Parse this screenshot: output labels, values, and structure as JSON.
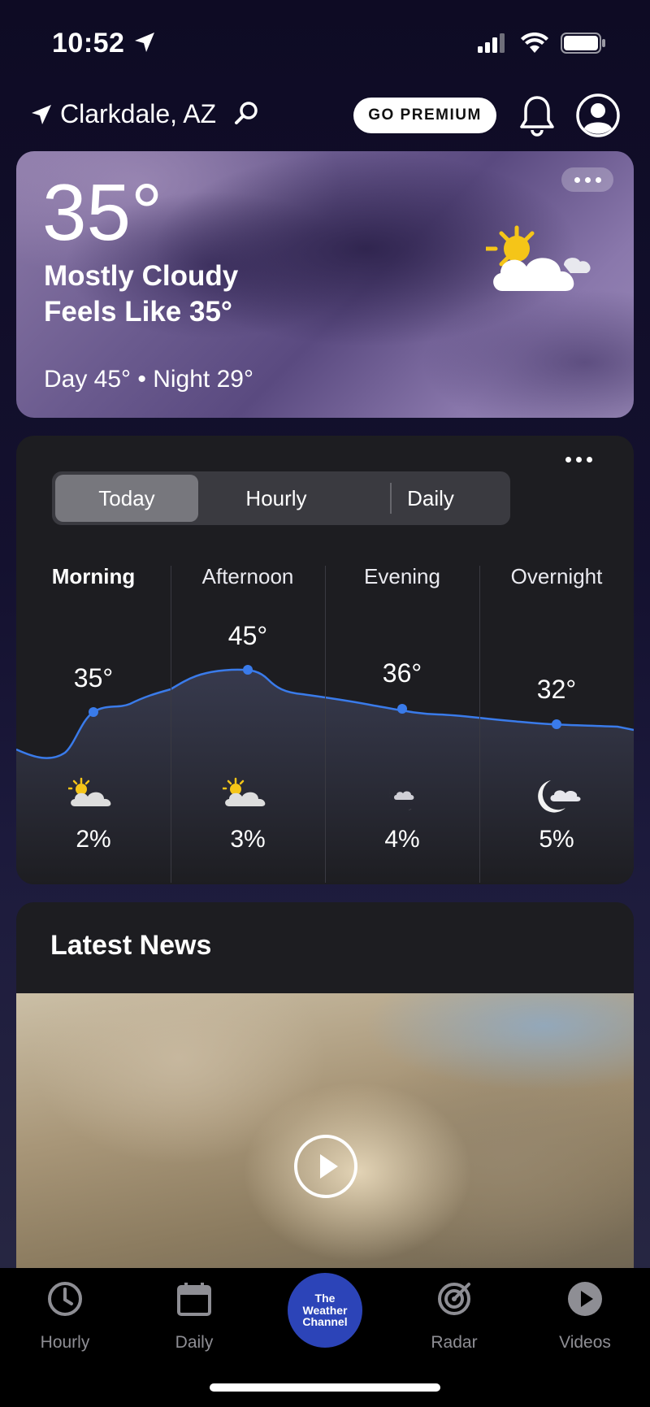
{
  "status_bar": {
    "time": "10:52"
  },
  "header": {
    "location": "Clarkdale, AZ",
    "premium_label": "GO PREMIUM"
  },
  "current": {
    "temperature": "35°",
    "condition": "Mostly Cloudy",
    "feels_like": "Feels Like 35°",
    "day_night": "Day 45° • Night 29°",
    "icon": "partly-cloudy-icon"
  },
  "forecast": {
    "tabs": [
      "Today",
      "Hourly",
      "Daily"
    ],
    "selected_tab": "Today",
    "periods": [
      {
        "label": "Morning",
        "temp": "35°",
        "precip": "2%",
        "icon": "partly-cloudy-day-icon"
      },
      {
        "label": "Afternoon",
        "temp": "45°",
        "precip": "3%",
        "icon": "partly-cloudy-day-icon"
      },
      {
        "label": "Evening",
        "temp": "36°",
        "precip": "4%",
        "icon": "night-cloudy-icon"
      },
      {
        "label": "Overnight",
        "temp": "32°",
        "precip": "5%",
        "icon": "night-cloudy-icon"
      }
    ]
  },
  "news": {
    "title": "Latest News"
  },
  "tab_bar": {
    "items": [
      {
        "label": "Hourly",
        "icon": "clock-icon"
      },
      {
        "label": "Daily",
        "icon": "calendar-icon"
      },
      {
        "label": "Radar",
        "icon": "radar-icon"
      },
      {
        "label": "Videos",
        "icon": "play-icon"
      }
    ],
    "logo_lines": [
      "The",
      "Weather",
      "Channel"
    ]
  },
  "colors": {
    "accent_blue": "#3a7bea",
    "logo_blue": "#2c44b8",
    "card_bg": "#1d1d21"
  }
}
